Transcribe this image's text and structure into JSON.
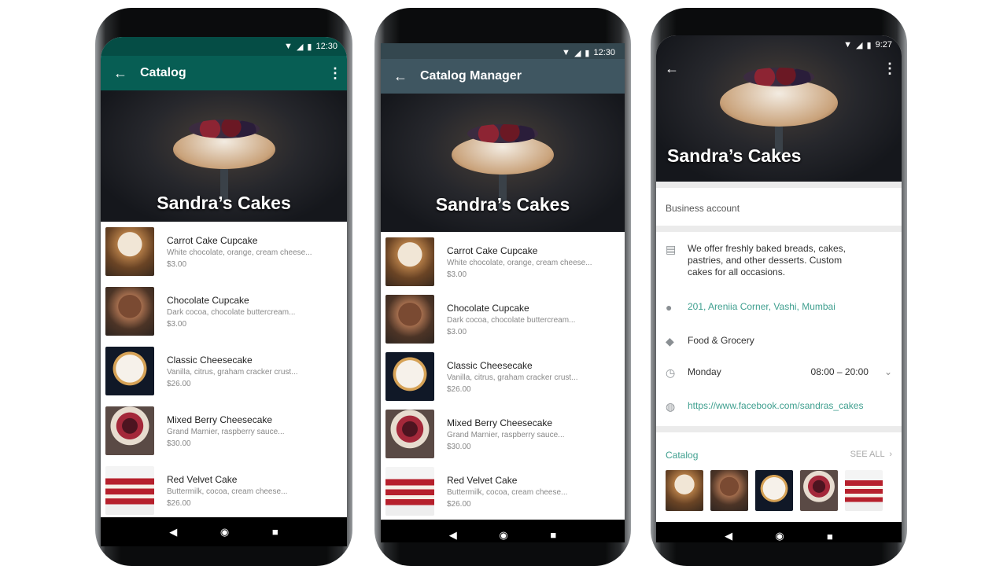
{
  "colors": {
    "catalog_header": "#075e54",
    "catalog_status": "#054d45",
    "manager_header": "#3f5661",
    "manager_status": "#34474f",
    "link": "#3f9f8f"
  },
  "phones": [
    {
      "time": "12:30",
      "title": "Catalog",
      "back_icon": "arrow-left-icon",
      "menu_icon": "more-vertical-icon",
      "hero_title": "Sandra’s Cakes"
    },
    {
      "time": "12:30",
      "title": "Catalog Manager",
      "back_icon": "arrow-left-icon",
      "hero_title": "Sandra’s Cakes"
    },
    {
      "time": "9:27",
      "hero_title": "Sandra’s Cakes"
    }
  ],
  "products": [
    {
      "name": "Carrot Cake Cupcake",
      "desc": "White chocolate, orange, cream cheese...",
      "price": "$3.00"
    },
    {
      "name": "Chocolate Cupcake",
      "desc": "Dark cocoa, chocolate buttercream...",
      "price": "$3.00"
    },
    {
      "name": "Classic Cheesecake",
      "desc": "Vanilla, citrus, graham cracker crust...",
      "price": "$26.00"
    },
    {
      "name": "Mixed Berry Cheesecake",
      "desc": "Grand Marnier, raspberry sauce...",
      "price": "$30.00"
    },
    {
      "name": "Red Velvet Cake",
      "desc": "Buttermilk, cocoa, cream cheese...",
      "price": "$26.00"
    }
  ],
  "profile": {
    "account_type": "Business account",
    "description": "We offer freshly baked breads, cakes, pastries, and other desserts. Custom cakes for all occasions.",
    "address": "201, Areniia Corner, Vashi, Mumbai",
    "category": "Food & Grocery",
    "hours_day": "Monday",
    "hours_time": "08:00 – 20:00",
    "website": "https://www.facebook.com/sandras_cakes",
    "catalog_label": "Catalog",
    "see_all": "SEE ALL"
  },
  "nav": {
    "back": "◀",
    "home": "◉",
    "recents": "■"
  }
}
